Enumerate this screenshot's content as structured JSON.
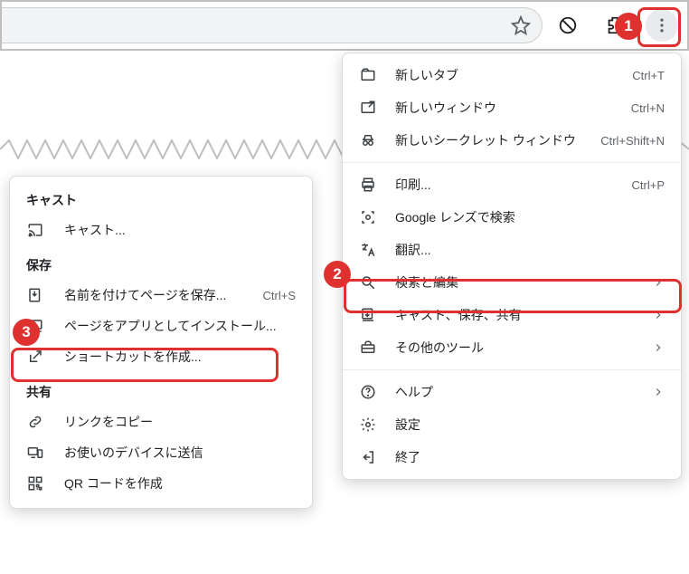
{
  "callouts": {
    "one": "1",
    "two": "2",
    "three": "3"
  },
  "mainMenu": {
    "newTab": {
      "label": "新しいタブ",
      "shortcut": "Ctrl+T"
    },
    "newWindow": {
      "label": "新しいウィンドウ",
      "shortcut": "Ctrl+N"
    },
    "incognito": {
      "label": "新しいシークレット ウィンドウ",
      "shortcut": "Ctrl+Shift+N"
    },
    "print": {
      "label": "印刷...",
      "shortcut": "Ctrl+P"
    },
    "lensSearch": {
      "label": "Google レンズで検索"
    },
    "translate": {
      "label": "翻訳..."
    },
    "findEdit": {
      "label": "検索と編集"
    },
    "castSaveShare": {
      "label": "キャスト、保存、共有"
    },
    "moreTools": {
      "label": "その他のツール"
    },
    "help": {
      "label": "ヘルプ"
    },
    "settings": {
      "label": "設定"
    },
    "exit": {
      "label": "終了"
    }
  },
  "subMenu": {
    "castHeader": "キャスト",
    "cast": {
      "label": "キャスト..."
    },
    "saveHeader": "保存",
    "saveAs": {
      "label": "名前を付けてページを保存...",
      "shortcut": "Ctrl+S"
    },
    "installApp": {
      "label": "ページをアプリとしてインストール..."
    },
    "shortcut": {
      "label": "ショートカットを作成..."
    },
    "shareHeader": "共有",
    "copyLink": {
      "label": "リンクをコピー"
    },
    "sendDevice": {
      "label": "お使いのデバイスに送信"
    },
    "qr": {
      "label": "QR コードを作成"
    }
  }
}
